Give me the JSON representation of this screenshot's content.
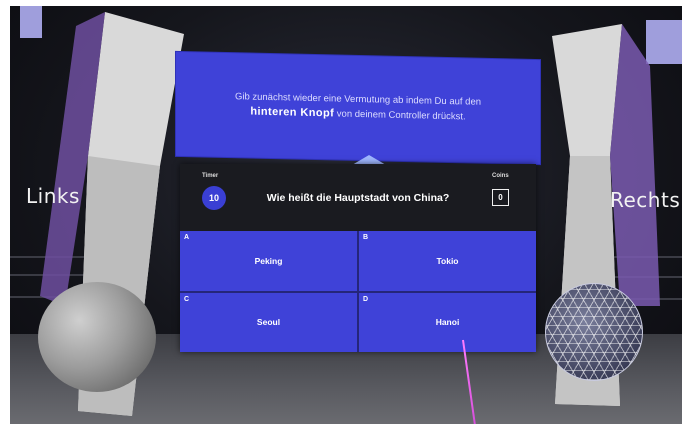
{
  "scene": {
    "left_label": "Links",
    "right_label": "Rechts"
  },
  "instruction": {
    "line1": "Gib zunächst wieder eine Vermutung ab indem Du auf den",
    "bold": "hinteren Knopf",
    "line2_rest": " von deinem Controller drückst."
  },
  "quiz": {
    "timer_label": "Timer",
    "timer_value": "10",
    "coins_label": "Coins",
    "coins_value": "0",
    "question": "Wie heißt die Hauptstadt von China?",
    "answers": [
      {
        "letter": "A",
        "text": "Peking"
      },
      {
        "letter": "B",
        "text": "Tokio"
      },
      {
        "letter": "C",
        "text": "Seoul"
      },
      {
        "letter": "D",
        "text": "Hanoi"
      }
    ]
  },
  "colors": {
    "board_blue": "#3f42d8",
    "laser": "#ff7cff"
  }
}
